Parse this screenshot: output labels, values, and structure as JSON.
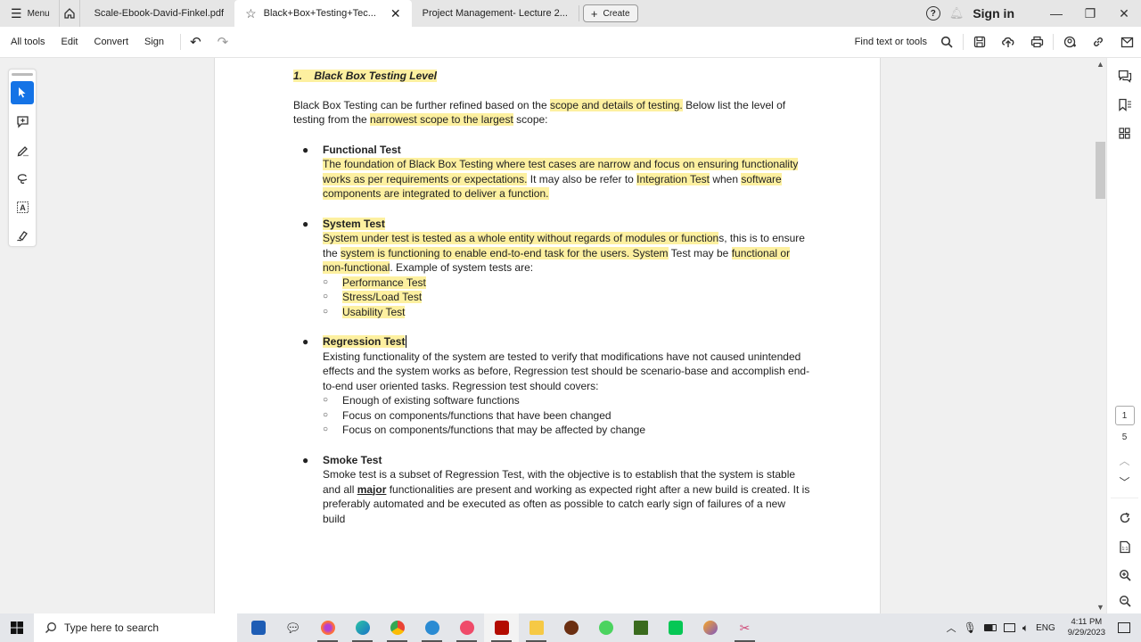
{
  "tabbar": {
    "menu_label": "Menu",
    "tabs": [
      {
        "label": "Scale-Ebook-David-Finkel.pdf",
        "active": false
      },
      {
        "label": "Black+Box+Testing+Tec...",
        "active": true
      },
      {
        "label": "Project Management- Lecture 2...",
        "active": false
      }
    ],
    "create_label": "Create",
    "sign_in_label": "Sign in"
  },
  "toolbar": {
    "items": [
      "All tools",
      "Edit",
      "Convert",
      "Sign"
    ],
    "find_label": "Find text or tools"
  },
  "page_nav": {
    "current_page": "1",
    "total_pages": "5"
  },
  "document": {
    "heading_number": "1.",
    "heading_text": "Black Box Testing Level",
    "intro": {
      "p1": "Black Box Testing can be further refined based on the ",
      "h1": "scope and details of testing.",
      "p2": " Below list the level of testing from the ",
      "h2": "narrowest scope to the largest",
      "p3": " scope:"
    },
    "functional": {
      "title": "Functional Test",
      "h1": "The foundation of Black Box Testing where test cases are narrow and focus on ensuring functionality works as per requirements or expectations.",
      "p1": " It may also be refer to ",
      "h2": "Integration Test",
      "p2": " when ",
      "h3": "software components are integrated to deliver a function."
    },
    "system": {
      "title": "System Test",
      "h1": "System under test is tested as a whole entity without regards of modules or function",
      "p1": "s, this is to ensure the ",
      "h2": "system is functioning to enable end-to-end task for the users. System",
      "p2": " Test may be ",
      "h3": "functional or non-functional",
      "p3": ". Example of system tests are:",
      "subitems": [
        "Performance Test",
        "Stress/Load Test",
        "Usability Test"
      ]
    },
    "regression": {
      "title": "Regression Test",
      "body": "Existing functionality of the system are tested to verify that modifications have not caused unintended effects and the system works as before, Regression test should be scenario-base and accomplish end-to-end user oriented tasks. Regression test should covers:",
      "subitems": [
        "Enough of existing software functions",
        "Focus on components/functions that have been changed",
        "Focus on components/functions that may be affected by change"
      ]
    },
    "smoke": {
      "title": "Smoke Test",
      "p1": "Smoke test is a subset of Regression Test, with the objective is to establish that the system is stable and all ",
      "bold": "major",
      "p2": " functionalities are present and working as expected right after a new build is created. It is preferably automated and be executed as often as possible to catch early sign of failures of a new build"
    }
  },
  "taskbar": {
    "search_placeholder": "Type here to search",
    "language": "ENG",
    "time": "4:11 PM",
    "date": "9/29/2023"
  },
  "colors": {
    "highlight": "#fdf0a0",
    "accent": "#1473e6"
  }
}
